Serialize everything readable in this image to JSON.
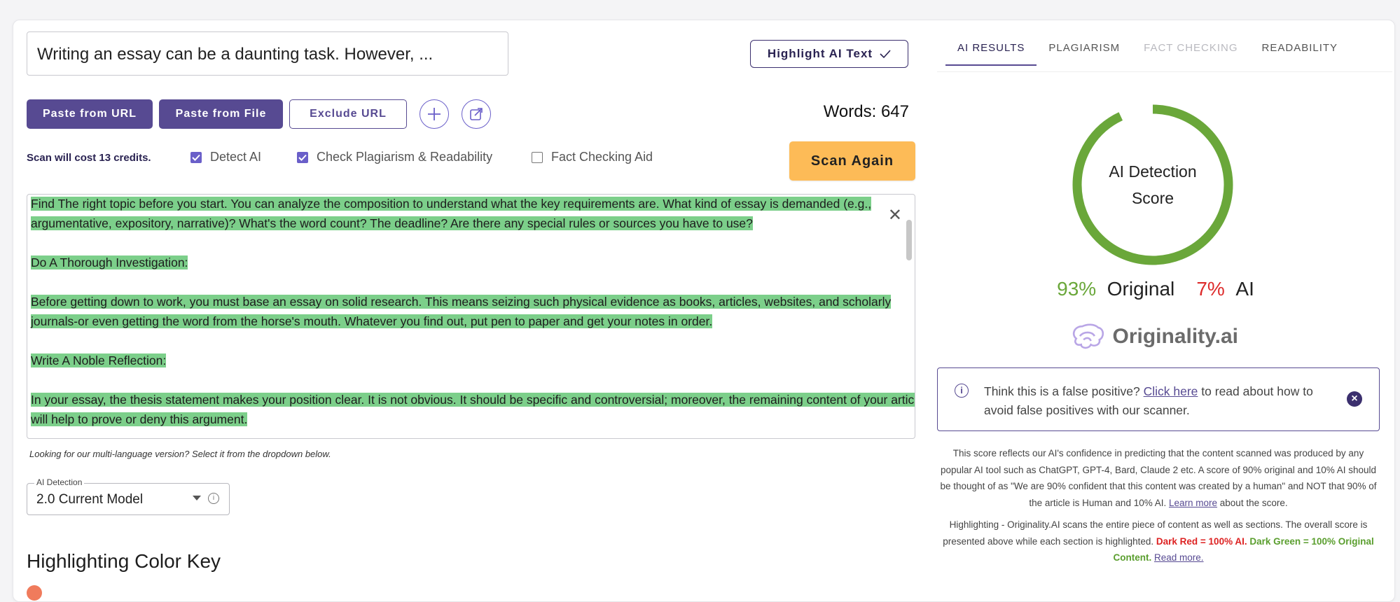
{
  "editor": {
    "title_value": "Writing an essay can be a daunting task. However, ...",
    "highlight_button": "Highlight AI Text",
    "paste_url": "Paste from URL",
    "paste_file": "Paste from File",
    "exclude_url": "Exclude URL",
    "word_count": "Words: 647",
    "cost_text": "Scan will cost 13 credits.",
    "options": [
      {
        "label": "Detect AI",
        "checked": true
      },
      {
        "label": "Check Plagiarism & Readability",
        "checked": true
      },
      {
        "label": "Fact Checking Aid",
        "checked": false
      }
    ],
    "scan_button": "Scan Again",
    "content": [
      "Find The right topic before you start. You can analyze the composition to understand what the key requirements are. What kind of essay is demanded (e.g., argumentative, expository, narrative)? What's the word count? The deadline? Are there any special rules or sources you have to use?",
      "Do A Thorough Investigation:",
      "Before getting down to work, you must base an essay on solid research. This means seizing such physical evidence as books, articles, websites, and scholarly journals-or even getting the word from the horse's mouth. Whatever you find out, put pen to paper and get your notes in order.",
      "Write A Noble Reflection:",
      "In your essay, the thesis statement makes your position clear. It is not obvious. It should be specific and controversial; moreover, the remaining content of your article will help to prove or deny this argument."
    ],
    "multilang_note": "Looking for our multi-language version? Select it from the dropdown below.",
    "model_select": {
      "legend": "AI Detection",
      "value": "2.0 Current Model"
    },
    "color_key_heading": "Highlighting Color Key"
  },
  "results": {
    "tabs": [
      {
        "label": "AI RESULTS",
        "state": "active"
      },
      {
        "label": "PLAGIARISM",
        "state": "normal"
      },
      {
        "label": "FACT CHECKING",
        "state": "disabled"
      },
      {
        "label": "READABILITY",
        "state": "normal"
      }
    ],
    "score_label_line1": "AI Detection",
    "score_label_line2": "Score",
    "original_pct": 93,
    "ai_pct": 7,
    "original_pct_text": "93%",
    "original_label": "Original",
    "ai_pct_text": "7%",
    "ai_label": "AI",
    "brand": "Originality.ai",
    "false_positive": {
      "before_link": "Think this is a false positive? ",
      "link": "Click here",
      "after_link": " to read about how to avoid false positives with our scanner."
    },
    "disclaimer_1_text": "This score reflects our AI's confidence in predicting that the content scanned was produced by any popular AI tool such as ChatGPT, GPT-4, Bard, Claude 2 etc. A score of 90% original and 10% AI should be thought of as \"We are 90% confident that this content was created by a human\" and NOT that 90% of the article is Human and 10% AI. Learn more about the score. ",
    "disclaimer_1_link": "Learn more",
    "disclaimer_1_tail": " about the score.",
    "disclaimer_2_text": "Highlighting - Originality.AI scans the entire piece of content as well as sections. The overall score is presented above while each section is highlighted. ",
    "dark_red_text": "Dark Red = 100% AI.",
    "dark_green_text": "Dark Green = 100% Original Content.",
    "read_more": "Read more.",
    "colors": {
      "original": "#6aa73a",
      "ai": "#dd2b2b",
      "accent": "#574a92",
      "scan_button": "#fdbb57",
      "highlight": "#7ccf8a"
    }
  }
}
